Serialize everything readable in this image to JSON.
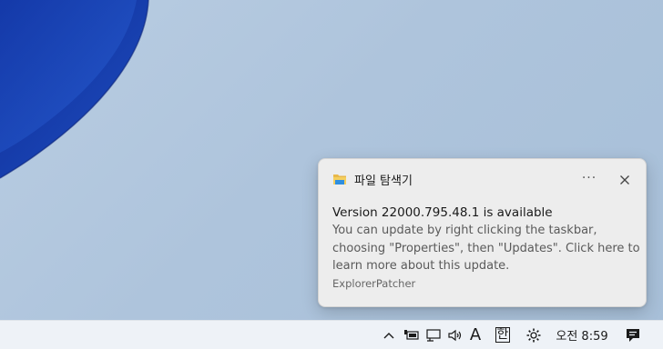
{
  "notification": {
    "app_name": "파일 탐색기",
    "more_label": "···",
    "title": "Version 22000.795.48.1 is available",
    "body": "You can update by right clicking the taskbar, choosing \"Properties\", then \"Updates\". Click here to learn more about this update.",
    "attribution": "ExplorerPatcher",
    "icons": {
      "app": "folder-icon",
      "close": "close-icon"
    }
  },
  "taskbar": {
    "ime_mode": "A",
    "ime_lang": "한",
    "clock": "오전 8:59",
    "icons": [
      "chevron-up-icon",
      "battery-icon",
      "network-icon",
      "speaker-icon",
      "settings-icon",
      "notification-icon"
    ]
  },
  "colors": {
    "wallpaper_blue": "#1a3fa8",
    "toast_bg": "#ededed",
    "taskbar_bg": "#eef2f7"
  }
}
